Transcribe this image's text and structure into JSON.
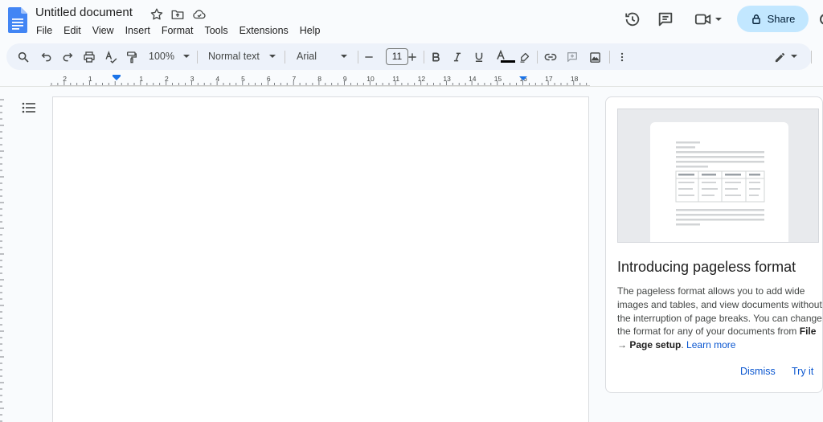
{
  "document": {
    "title": "Untitled document"
  },
  "menus": [
    "File",
    "Edit",
    "View",
    "Insert",
    "Format",
    "Tools",
    "Extensions",
    "Help"
  ],
  "header": {
    "share_label": "Share",
    "icons": [
      "star-icon",
      "move-to-folder-icon",
      "cloud-saved-icon",
      "version-history-icon",
      "comments-icon",
      "meet-video-icon"
    ]
  },
  "toolbar": {
    "zoom": "100%",
    "paragraph_style": "Normal text",
    "font_family": "Arial",
    "font_size": "11",
    "text_color": "#000000"
  },
  "ruler": {
    "labels_left": [
      "2",
      "1"
    ],
    "labels_right": [
      "1",
      "2",
      "3",
      "4",
      "5",
      "6",
      "7",
      "8",
      "9",
      "10",
      "11",
      "12",
      "13",
      "14",
      "15",
      "16",
      "17",
      "18"
    ]
  },
  "card": {
    "title": "Introducing pageless format",
    "body_text": "The pageless format allows you to add wide images and tables, and view documents without the interruption of page breaks. You can change the format for any of your documents from ",
    "body_file": "File",
    "body_arrow": " → ",
    "body_page_setup": "Page setup",
    "body_period": ". ",
    "learn_more": "Learn more",
    "dismiss": "Dismiss",
    "try_it": "Try it"
  },
  "colors": {
    "accent": "#0b57d0",
    "share_bg": "#c2e7ff",
    "toolbar_bg": "#edf2fa",
    "docs_blue": "#4285f4"
  }
}
